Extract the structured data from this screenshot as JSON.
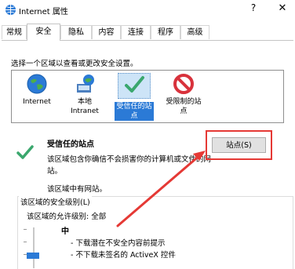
{
  "window": {
    "title": "Internet 属性",
    "help_label": "?",
    "close_label": "✕"
  },
  "tabs": [
    {
      "label": "常规",
      "active": false
    },
    {
      "label": "安全",
      "active": true
    },
    {
      "label": "隐私",
      "active": false
    },
    {
      "label": "内容",
      "active": false
    },
    {
      "label": "连接",
      "active": false
    },
    {
      "label": "程序",
      "active": false
    },
    {
      "label": "高级",
      "active": false
    }
  ],
  "security": {
    "instruction": "选择一个区域以查看或更改安全设置。",
    "zones": [
      {
        "label": "Internet",
        "icon": "globe-icon"
      },
      {
        "label": "本地\nIntranet",
        "icon": "intranet-icon"
      },
      {
        "label": "受信任的站\n点",
        "icon": "checkmark-icon",
        "selected": true
      },
      {
        "label": "受限制的站\n点",
        "icon": "restricted-icon"
      }
    ],
    "selected_zone": {
      "title": "受信任的站点",
      "description": "该区域包含你确信不会损害你的计算机或文件的网站。",
      "note": "该区域中有网站。",
      "sites_button": "站点(S)"
    },
    "level": {
      "legend": "该区域的安全级别(L)",
      "allowed_levels": "该区域的允许级别: 全部",
      "current_level": "中",
      "details": [
        "- 下载潜在不安全内容前提示",
        "- 不下载未签名的 ActiveX 控件"
      ]
    }
  },
  "colors": {
    "accent": "#2b7ad6",
    "annotation": "#e53935",
    "check": "#3aa76d"
  }
}
